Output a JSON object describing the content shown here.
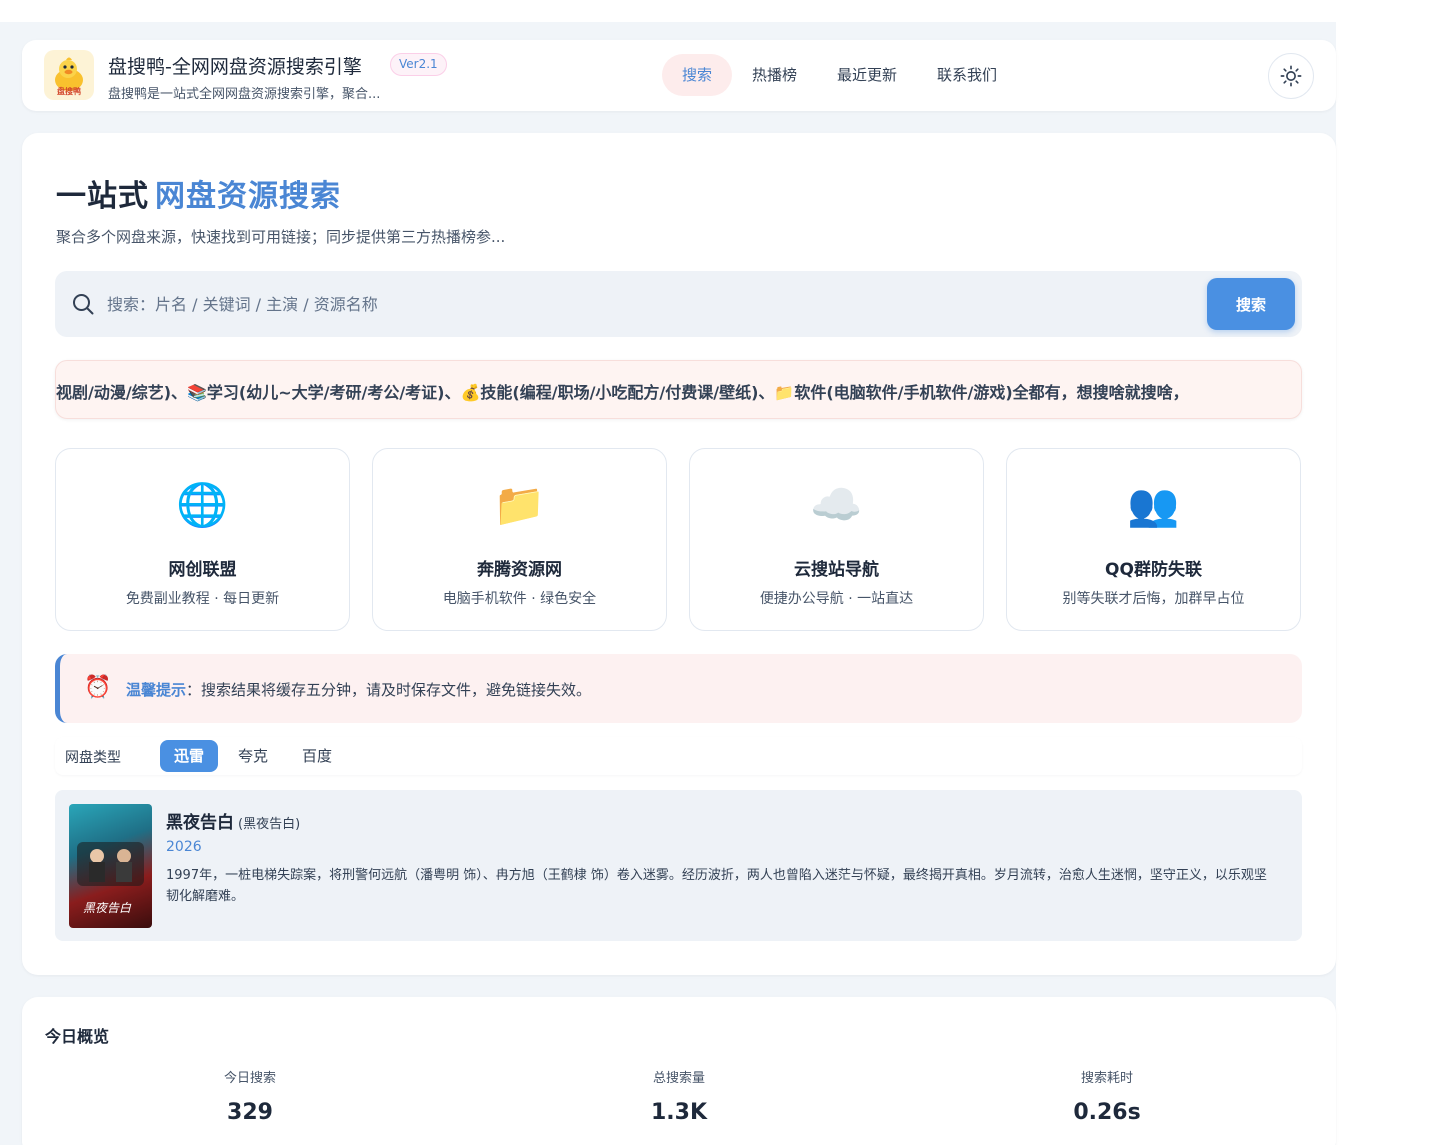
{
  "header": {
    "title": "盘搜鸭-全网网盘资源搜索引擎",
    "version": "Ver2.1",
    "description": "盘搜鸭是一站式全网网盘资源搜索引擎，聚合...",
    "logo_text": "盘搜鸭",
    "nav": [
      {
        "label": "搜索",
        "active": true
      },
      {
        "label": "热播榜",
        "active": false
      },
      {
        "label": "最近更新",
        "active": false
      },
      {
        "label": "联系我们",
        "active": false
      }
    ],
    "theme_icon": "sun-icon"
  },
  "hero": {
    "title_plain": "一站式",
    "title_accent": "网盘资源搜索",
    "subtitle": "聚合多个网盘来源，快速找到可用链接；同步提供第三方热播榜参...",
    "accent_color": "#4a86d4"
  },
  "search": {
    "placeholder": "搜索：片名 / 关键词 / 主演 / 资源名称",
    "value": "",
    "button_label": "搜索",
    "button_color": "#4a90e2"
  },
  "marquee": {
    "text": "视剧/动漫/综艺)、📚学习(幼儿~大学/考研/考公/考证)、💰技能(编程/职场/小吃配方/付费课/壁纸)、📁软件(电脑软件/手机软件/游戏)全都有，想搜啥就搜啥，"
  },
  "tiles": [
    {
      "icon": "🌐",
      "icon_name": "globe-icon",
      "name": "网创联盟",
      "subtitle": "免费副业教程 · 每日更新"
    },
    {
      "icon": "📁",
      "icon_name": "folder-icon",
      "name": "奔腾资源网",
      "subtitle": "电脑手机软件 · 绿色安全"
    },
    {
      "icon": "☁️",
      "icon_name": "cloud-icon",
      "name": "云搜站导航",
      "subtitle": "便捷办公导航 · 一站直达"
    },
    {
      "icon": "👥",
      "icon_name": "users-icon",
      "name": "QQ群防失联",
      "subtitle": "别等失联才后悔，加群早占位"
    }
  ],
  "notice": {
    "icon": "⏰",
    "label": "温馨提示",
    "text": "：搜索结果将缓存五分钟，请及时保存文件，避免链接失效。"
  },
  "filter": {
    "label": "网盘类型",
    "tabs": [
      {
        "label": "迅雷",
        "active": true
      },
      {
        "label": "夸克",
        "active": false
      },
      {
        "label": "百度",
        "active": false
      }
    ]
  },
  "results": [
    {
      "title": "黑夜告白",
      "alt_title": "(黑夜告白)",
      "year": "2026",
      "poster_text": "黑夜告白",
      "description": "1997年，一桩电梯失踪案，将刑警何远航（潘粤明 饰）、冉方旭（王鹤棣 饰）卷入迷雾。经历波折，两人也曾陷入迷茫与怀疑，最终揭开真相。岁月流转，治愈人生迷惘，坚守正义，以乐观坚韧化解磨难。"
    }
  ],
  "stats": {
    "title": "今日概览",
    "items": [
      {
        "label": "今日搜索",
        "value": "329"
      },
      {
        "label": "总搜索量",
        "value": "1.3K"
      },
      {
        "label": "搜索耗时",
        "value": "0.26s"
      }
    ]
  }
}
